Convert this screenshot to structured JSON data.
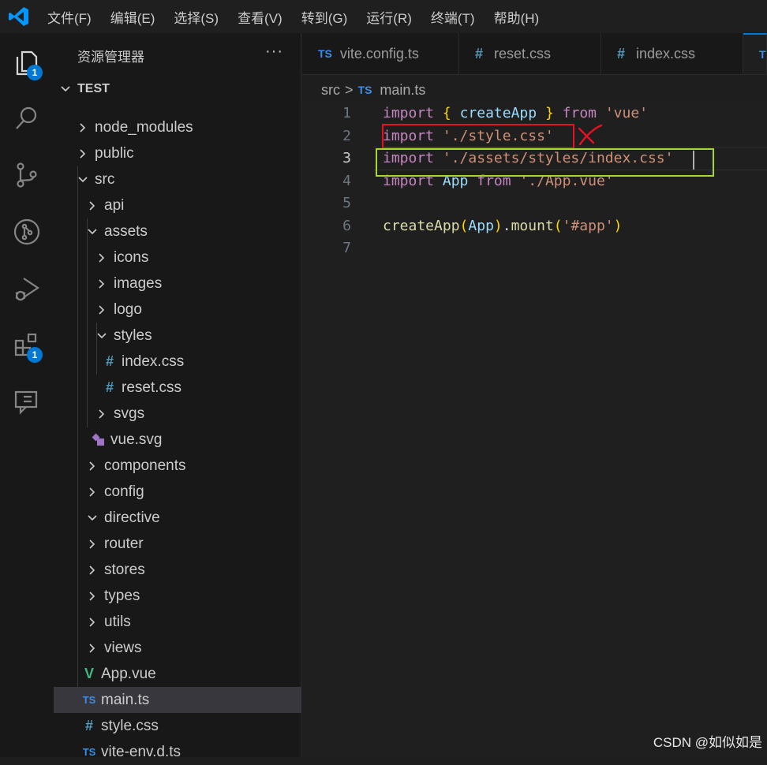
{
  "menu": [
    "文件(F)",
    "编辑(E)",
    "选择(S)",
    "查看(V)",
    "转到(G)",
    "运行(R)",
    "终端(T)",
    "帮助(H)"
  ],
  "activity_bar": {
    "explorer_badge": "1",
    "extensions_badge": "1"
  },
  "sidebar": {
    "title": "资源管理器",
    "more": "···",
    "root": "TEST",
    "items": [
      {
        "label": "node_modules"
      },
      {
        "label": "public"
      },
      {
        "label": "src"
      },
      {
        "label": "api"
      },
      {
        "label": "assets"
      },
      {
        "label": "icons"
      },
      {
        "label": "images"
      },
      {
        "label": "logo"
      },
      {
        "label": "styles"
      },
      {
        "label": "index.css",
        "icon": "#"
      },
      {
        "label": "reset.css",
        "icon": "#"
      },
      {
        "label": "svgs"
      },
      {
        "label": "vue.svg"
      },
      {
        "label": "components"
      },
      {
        "label": "config"
      },
      {
        "label": "directive"
      },
      {
        "label": "router"
      },
      {
        "label": "stores"
      },
      {
        "label": "types"
      },
      {
        "label": "utils"
      },
      {
        "label": "views"
      },
      {
        "label": "App.vue",
        "icon": "V"
      },
      {
        "label": "main.ts",
        "icon": "TS"
      },
      {
        "label": "style.css",
        "icon": "#"
      },
      {
        "label": "vite-env.d.ts",
        "icon": "TS"
      }
    ]
  },
  "tabs": [
    {
      "icon": "TS",
      "label": "vite.config.ts"
    },
    {
      "icon": "#",
      "label": "reset.css"
    },
    {
      "icon": "#",
      "label": "index.css"
    },
    {
      "icon": "T",
      "label": ""
    }
  ],
  "breadcrumb": {
    "folder": "src",
    "sep": ">",
    "icon": "TS",
    "file": "main.ts"
  },
  "editor": {
    "line_numbers": [
      "1",
      "2",
      "3",
      "4",
      "5",
      "6",
      "7"
    ],
    "current_line": 3,
    "lines": [
      {
        "t1": "import",
        "t2": "{",
        "t3": "createApp",
        "t4": "}",
        "t5": "from",
        "t6": "'vue'"
      },
      {
        "t1": "import",
        "t2": "'./style.css'"
      },
      {
        "t1": "import",
        "t2": "'./assets/styles/index.css'"
      },
      {
        "t1": "import",
        "t2": "App",
        "t3": "from",
        "t4": "'./App.vue'"
      },
      {},
      {
        "t1": "createApp",
        "t2": "(",
        "t3": "App",
        "t4": ")",
        "t5": ".",
        "t6": "mount",
        "t7": "(",
        "t8": "'#app'",
        "t9": ")"
      },
      {}
    ]
  },
  "watermark": "CSDN @如似如是",
  "colors": {
    "accent": "#0078d4",
    "red_annotation": "#e81123",
    "green_annotation": "#a4d82a"
  }
}
